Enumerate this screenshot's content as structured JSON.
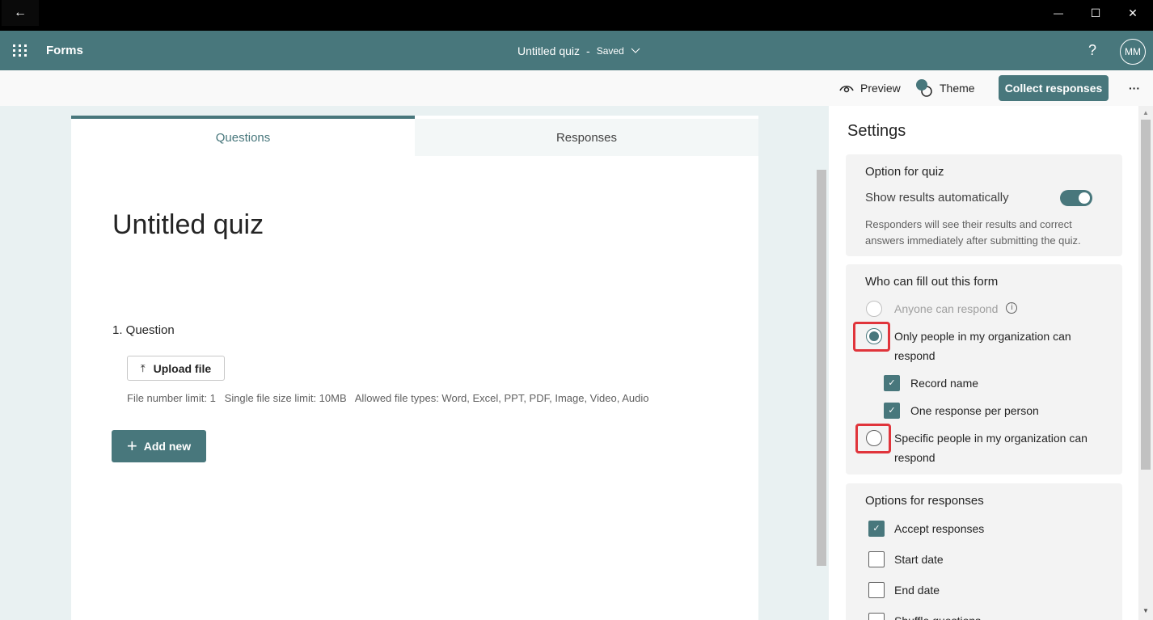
{
  "titlebar": {
    "back": "←",
    "minimize": "—",
    "maximize": "☐",
    "close": "✕"
  },
  "header": {
    "app_name": "Forms",
    "doc_title": "Untitled quiz",
    "separator": "-",
    "save_status": "Saved",
    "help": "?",
    "avatar": "MM"
  },
  "toolbar": {
    "preview": "Preview",
    "theme": "Theme",
    "collect": "Collect responses",
    "more": "···"
  },
  "tabs": [
    "Questions",
    "Responses"
  ],
  "form": {
    "title": "Untitled quiz",
    "question": "1. Question",
    "upload_label": "Upload file",
    "limits": "File number limit: 1   Single file size limit: 10MB   Allowed file types: Word, Excel, PPT, PDF, Image, Video, Audio",
    "add_new": "Add new"
  },
  "settings": {
    "title": "Settings",
    "quiz": {
      "heading": "Option for quiz",
      "toggle_label": "Show results automatically",
      "toggle_on": true,
      "description": "Responders will see their results and correct answers immediately after submitting the quiz."
    },
    "who": {
      "heading": "Who can fill out this form",
      "options": [
        {
          "label": "Anyone can respond",
          "selected": false,
          "disabled": true
        },
        {
          "label": "Only people in my organization can respond",
          "selected": true
        },
        {
          "label": "Specific people in my organization can respond",
          "selected": false
        }
      ],
      "sub": [
        {
          "label": "Record name",
          "checked": true
        },
        {
          "label": "One response per person",
          "checked": true
        }
      ]
    },
    "responses": {
      "heading": "Options for responses",
      "items": [
        {
          "label": "Accept responses",
          "checked": true
        },
        {
          "label": "Start date",
          "checked": false
        },
        {
          "label": "End date",
          "checked": false
        },
        {
          "label": "Shuffle questions",
          "checked": false
        }
      ]
    }
  },
  "colors": {
    "accent": "#48777c",
    "highlight": "#e0343b"
  }
}
